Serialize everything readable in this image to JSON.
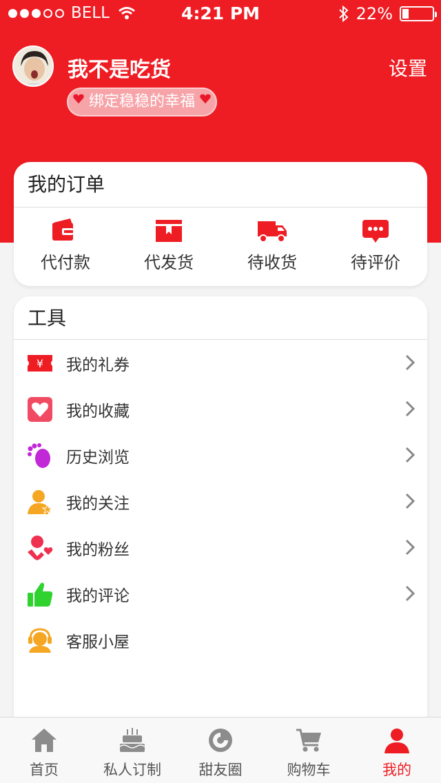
{
  "status_bar": {
    "carrier": "BELL",
    "time": "4:21 PM",
    "battery": "22%",
    "battery_level": 0.22
  },
  "profile": {
    "name": "我不是吃货",
    "settings_label": "设置",
    "bind_label": "绑定稳稳的幸福"
  },
  "orders": {
    "title": "我的订单",
    "items": [
      {
        "label": "代付款",
        "icon": "wallet-icon"
      },
      {
        "label": "代发货",
        "icon": "package-icon"
      },
      {
        "label": "待收货",
        "icon": "truck-icon"
      },
      {
        "label": "待评价",
        "icon": "comment-icon"
      }
    ]
  },
  "tools": {
    "title": "工具",
    "items": [
      {
        "label": "我的礼券",
        "icon": "coupon-icon"
      },
      {
        "label": "我的收藏",
        "icon": "heart-icon"
      },
      {
        "label": "历史浏览",
        "icon": "footprint-icon"
      },
      {
        "label": "我的关注",
        "icon": "follow-icon"
      },
      {
        "label": "我的粉丝",
        "icon": "fans-icon"
      },
      {
        "label": "我的评论",
        "icon": "thumbs-up-icon"
      },
      {
        "label": "客服小屋",
        "icon": "customer-service-icon"
      }
    ]
  },
  "tabbar": {
    "items": [
      {
        "label": "首页",
        "icon": "home-icon"
      },
      {
        "label": "私人订制",
        "icon": "cake-icon"
      },
      {
        "label": "甜友圈",
        "icon": "circle-icon"
      },
      {
        "label": "购物车",
        "icon": "cart-icon"
      },
      {
        "label": "我的",
        "icon": "user-icon"
      }
    ],
    "active_label": "我的"
  },
  "colors": {
    "brand_red": "#ee1c23",
    "tab_gray": "#8c8c8c",
    "chevron": "#888888"
  }
}
